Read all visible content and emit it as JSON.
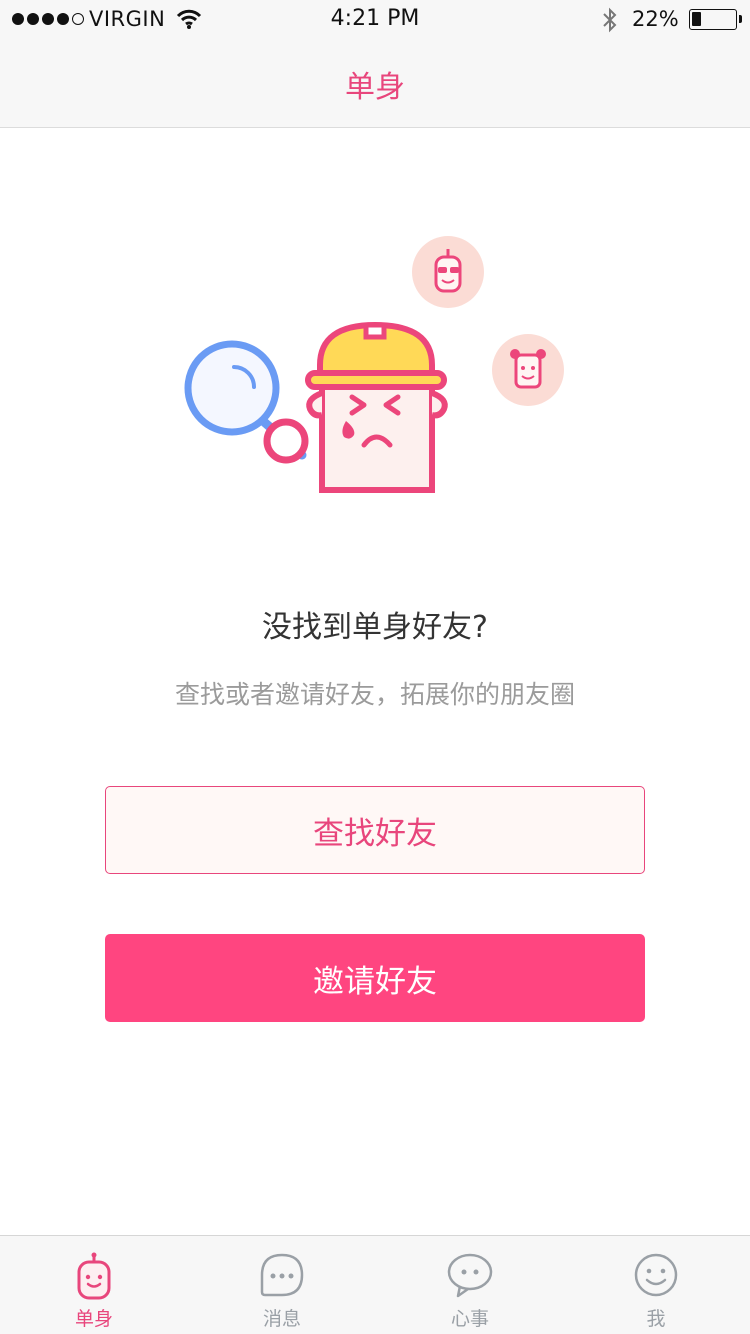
{
  "status_bar": {
    "carrier": "VIRGIN",
    "time": "4:21 PM",
    "battery_percent": "22%",
    "battery_level": 0.22,
    "signal_bars_filled": 4,
    "signal_bars_total": 5
  },
  "nav": {
    "title": "单身"
  },
  "empty_state": {
    "title": "没找到单身好友?",
    "subtitle": "查找或者邀请好友，拓展你的朋友圈",
    "illustration": "sad-helmet-character-with-magnifier"
  },
  "buttons": {
    "find_friends": "查找好友",
    "invite_friends": "邀请好友"
  },
  "tabs": [
    {
      "label": "单身",
      "icon": "single-character-icon",
      "active": true
    },
    {
      "label": "消息",
      "icon": "message-bubble-icon",
      "active": false
    },
    {
      "label": "心事",
      "icon": "chat-bubble-icon",
      "active": false
    },
    {
      "label": "我",
      "icon": "smiley-face-icon",
      "active": false
    }
  ],
  "colors": {
    "accent": "#e8467c",
    "primary_button": "#ff4580",
    "secondary_button_bg": "#fff8f6",
    "tab_inactive": "#9aa0a6"
  }
}
